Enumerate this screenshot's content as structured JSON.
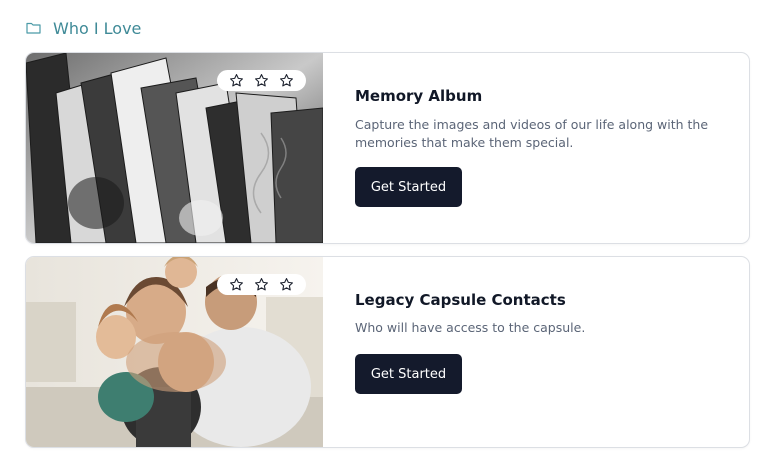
{
  "breadcrumb": {
    "label": "Who I Love",
    "icon": "folder-icon"
  },
  "cards": [
    {
      "title": "Memory Album",
      "description": "Capture the images and videos of our life along with the memories that make them special.",
      "button_label": "Get Started",
      "rating": {
        "stars": 3,
        "filled": 0
      }
    },
    {
      "title": "Legacy Capsule Contacts",
      "description": "Who will have access to the capsule.",
      "button_label": "Get Started",
      "rating": {
        "stars": 3,
        "filled": 0
      }
    }
  ],
  "colors": {
    "breadcrumb": "#3f8a97",
    "button_bg": "#141a2c",
    "card_border": "#dcdfe4",
    "description_text": "#5b6577"
  }
}
